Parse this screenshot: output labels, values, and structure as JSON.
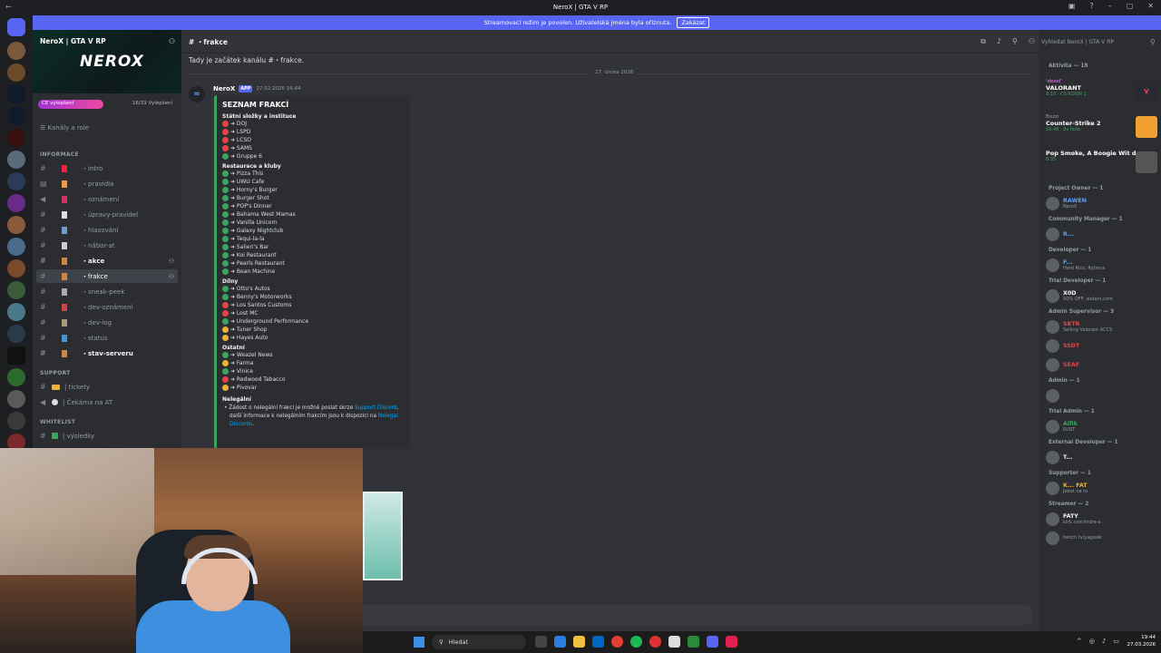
{
  "window": {
    "title": "NeroX | GTA V RP"
  },
  "banner": {
    "text": "Streamovací režim je povolen. Uživatelská jména byla ořiznuta.",
    "button": "Zakázat"
  },
  "server": {
    "name": "NeroX | GTA V RP",
    "logo": "NEROX",
    "boost_label": "CE vylepšení",
    "boost_count": "16/33 Vylepšení",
    "boost_progress": 0.48
  },
  "sidebar": {
    "channels_roles": "Kanály a role",
    "cat_info": "INFORMACE",
    "cat_support": "SUPPORT",
    "cat_whitelist": "WHITELIST",
    "channels": [
      {
        "name": "・intro"
      },
      {
        "name": "・pravidla"
      },
      {
        "name": "・oznámení"
      },
      {
        "name": "・úpravy-pravidel"
      },
      {
        "name": "・hlasování"
      },
      {
        "name": "・nábor-at"
      },
      {
        "name": "・akce"
      },
      {
        "name": "・frakce"
      },
      {
        "name": "・sneak-peek"
      },
      {
        "name": "・dev-oznámení"
      },
      {
        "name": "・dev-log"
      },
      {
        "name": "・status"
      },
      {
        "name": "・stav-serveru"
      }
    ],
    "support": [
      {
        "name": "| tickety"
      },
      {
        "name": "| Čekárna na AT"
      }
    ],
    "whitelist": [
      {
        "name": "| výsledky"
      }
    ]
  },
  "channel": {
    "name": "・frakce",
    "start_text": "Tady je začátek kanálu #",
    "start_suffix": "・frakce.",
    "date_divider": "27. února 2026"
  },
  "message": {
    "author": "NeroX",
    "badge": "APP",
    "timestamp": "27.02.2026 16:44",
    "embed_title": "SEZNAM FRAKCÍ",
    "sections": [
      {
        "title": "Státní složky a instituce",
        "items": [
          {
            "name": "➜ DOJ",
            "status": "red"
          },
          {
            "name": "➜ LSPD",
            "status": "red"
          },
          {
            "name": "➜ LCSO",
            "status": "red"
          },
          {
            "name": "➜ SAMS",
            "status": "red"
          },
          {
            "name": "➜ Gruppe 6",
            "status": "green"
          }
        ]
      },
      {
        "title": "Restaurace a kluby",
        "items": [
          {
            "name": "➜ Pizza This",
            "status": "green"
          },
          {
            "name": "➜ UWU Cafe",
            "status": "green"
          },
          {
            "name": "➜ Horny's Burger",
            "status": "green"
          },
          {
            "name": "➜ Burger Shot",
            "status": "green"
          },
          {
            "name": "➜ POP's Dinner",
            "status": "green"
          },
          {
            "name": "➜ Bahama West Mamas",
            "status": "green"
          },
          {
            "name": "➜ Vanilla Unicorn",
            "status": "green"
          },
          {
            "name": "➜ Galaxy Nightclub",
            "status": "green"
          },
          {
            "name": "➜ Tequi-la-la",
            "status": "green"
          },
          {
            "name": "➜ Salieri's Bar",
            "status": "green"
          },
          {
            "name": "➜ Koi Restaurant",
            "status": "green"
          },
          {
            "name": "➜ Pearls Restaurant",
            "status": "green"
          },
          {
            "name": "➜ Bean Machine",
            "status": "green"
          }
        ]
      },
      {
        "title": "Dílny",
        "items": [
          {
            "name": "➜ Otto's Autos",
            "status": "green"
          },
          {
            "name": "➜ Benny's Motorworks",
            "status": "green"
          },
          {
            "name": "➜ Los Santos Customs",
            "status": "red"
          },
          {
            "name": "➜ Lost MC",
            "status": "red"
          },
          {
            "name": "➜ Underground Performance",
            "status": "green"
          },
          {
            "name": "➜ Tuner Shop",
            "status": "orange"
          },
          {
            "name": "➜ Hayes Auto",
            "status": "orange"
          }
        ]
      },
      {
        "title": "Ostatní",
        "items": [
          {
            "name": "➜ Weazel News",
            "status": "green"
          },
          {
            "name": "➜ Farma",
            "status": "orange"
          },
          {
            "name": "➜ Vinice",
            "status": "green"
          },
          {
            "name": "➜ Redwood Tabacco",
            "status": "red"
          },
          {
            "name": "➜ Pivovar",
            "status": "orange"
          }
        ]
      }
    ],
    "illegal_title": "Nelegální",
    "illegal_text_1": "Žádost o nelegální frakci je možné poslat skrze ",
    "illegal_link_1": "Support Discord",
    "illegal_text_2": ", další informace k nelegálním frakcím jsou k dispozici na ",
    "illegal_link_2": "Nelegal Discordu",
    "illegal_text_3": "."
  },
  "members": {
    "search_placeholder": "Vyhledat NeroX | GTA V RP",
    "activity_header": "Aktivita — 18",
    "activities": [
      {
        "who": "'dexel'",
        "game": "VALORANT",
        "meta": "9:19 · CS ROOM 1"
      },
      {
        "who": "Bozzi",
        "game": "Counter-Strike 2",
        "meta": "16:46 · 8v fada"
      },
      {
        "who": "",
        "game": "Pop Smoke, A Boogie Wit d...",
        "meta": "0:35"
      }
    ],
    "groups": [
      {
        "title": "Project Owner — 1",
        "members": [
          {
            "name": "RAWEN",
            "sub": "NeroX",
            "color": "#5aa0ff"
          }
        ]
      },
      {
        "title": "Community Manager — 1",
        "members": [
          {
            "name": "R...",
            "sub": "",
            "color": "#5aa0ff"
          }
        ]
      },
      {
        "title": "Developer — 1",
        "members": [
          {
            "name": "F...",
            "sub": "Hard Rico, Rytmus",
            "color": "#5aa0ff"
          }
        ]
      },
      {
        "title": "Trial Developer — 1",
        "members": [
          {
            "name": "X0D",
            "sub": "50% OFF: xodant.com",
            "color": "#f2f3f5"
          }
        ]
      },
      {
        "title": "Admin Supervisor — 3",
        "members": [
          {
            "name": "SBTR",
            "sub": "Selling Valorant ACCS",
            "color": "#ed4245"
          },
          {
            "name": "SSDT",
            "sub": "",
            "color": "#ed4245"
          },
          {
            "name": "SEAF",
            "sub": "",
            "color": "#ed4245"
          }
        ]
      },
      {
        "title": "Admin — 1",
        "members": [
          {
            "name": "",
            "sub": "",
            "color": "#5aa0ff"
          }
        ]
      },
      {
        "title": "Trial Admin — 1",
        "members": [
          {
            "name": "Alfik",
            "sub": "RUST",
            "color": "#3ba55d"
          }
        ]
      },
      {
        "title": "External Developer — 1",
        "members": [
          {
            "name": "T...",
            "sub": "",
            "color": "#f2f3f5"
          }
        ]
      },
      {
        "title": "Supporter — 1",
        "members": [
          {
            "name": "K... FAT",
            "sub": "Jebat na to",
            "color": "#f0b232"
          }
        ]
      },
      {
        "title": "Streamer — 2",
        "members": [
          {
            "name": "FATY",
            "sub": "kick.com/indra-a",
            "color": "#f2f3f5"
          },
          {
            "name": "",
            "sub": "twitch.tv/yagisek",
            "color": "#a970ff"
          }
        ]
      }
    ]
  },
  "taskbar": {
    "search": "Hledat",
    "time": "19:44",
    "date": "27.03.2026"
  },
  "colors": {
    "accent": "#5865f2",
    "success": "#3ba55d",
    "danger": "#ed4245",
    "warning": "#f0b232"
  }
}
